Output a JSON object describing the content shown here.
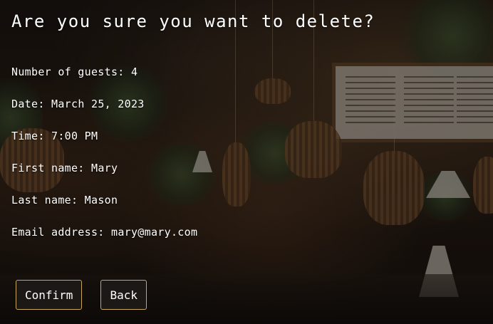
{
  "dialog": {
    "title": "Are you sure you want to delete?",
    "details": [
      {
        "label": "Number of guests:",
        "value": "4"
      },
      {
        "label": "Date:",
        "value": "March 25, 2023"
      },
      {
        "label": "Time:",
        "value": "7:00 PM"
      },
      {
        "label": "First name:",
        "value": "Mary"
      },
      {
        "label": "Last name:",
        "value": "Mason"
      },
      {
        "label": "Email address:",
        "value": "mary@mary.com"
      }
    ],
    "confirm_label": "Confirm",
    "back_label": "Back"
  },
  "colors": {
    "text": "#ffffff",
    "button_background": "#1c1815",
    "button_border": "#c9a75a"
  }
}
